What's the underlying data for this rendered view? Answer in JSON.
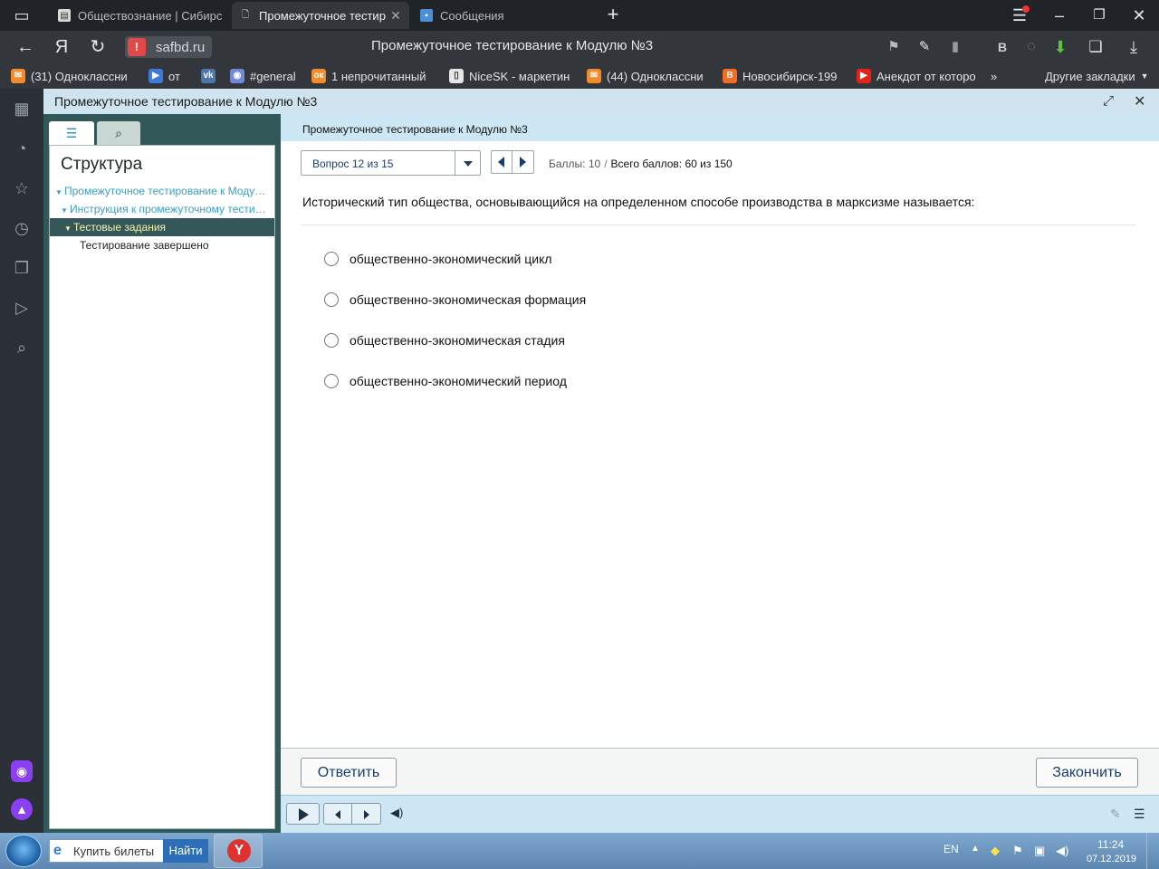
{
  "browser": {
    "tabs": [
      {
        "title": "Обществознание | Сибирс"
      },
      {
        "title": "Промежуточное тестир"
      },
      {
        "title": "Сообщения"
      }
    ],
    "address": {
      "domain": "safbd.ru",
      "page_title": "Промежуточное тестирование к Модулю №3"
    },
    "bookmarks": [
      {
        "label": "(31) Одноклассни",
        "color": "#f28b2c"
      },
      {
        "label": "от",
        "color": "#3d7bd9"
      },
      {
        "label": "",
        "color": "#4a76a8"
      },
      {
        "label": "#general",
        "color": "#7289da"
      },
      {
        "label": "1 непрочитанный",
        "color": "#f28b2c"
      },
      {
        "label": "NiceSK - маркетин",
        "color": "#e6e6e6"
      },
      {
        "label": "(44) Одноклассни",
        "color": "#f28b2c"
      },
      {
        "label": "Новосибирск-199",
        "color": "#f26d21"
      },
      {
        "label": "Анекдот от которо",
        "color": "#e62117"
      }
    ],
    "other_bookmarks": "Другие закладки"
  },
  "player": {
    "window_title": "Промежуточное тестирование к Модулю №3",
    "outline": {
      "heading": "Структура",
      "items": [
        {
          "label": "Промежуточное тестирование к Моду…",
          "level": 0
        },
        {
          "label": "Инструкция к промежуточному тести…",
          "level": 1
        },
        {
          "label": "Тестовые задания",
          "level": 1
        },
        {
          "label": "Тестирование завершено",
          "level": 2
        }
      ]
    },
    "header_title": "Промежуточное тестирование к Модулю №3",
    "question_select": "Вопрос 12 из 15",
    "score": {
      "points_label": "Баллы: 10",
      "total_label": "Всего баллов: 60 из 150"
    },
    "question": "Исторический тип общества, основывающийся на определенном способе производства в марксизме называется:",
    "options": [
      {
        "label": "общественно-экономический цикл"
      },
      {
        "label": "общественно-экономическая формация"
      },
      {
        "label": "общественно-экономическая стадия"
      },
      {
        "label": "общественно-экономический период"
      }
    ],
    "buttons": {
      "answer": "Ответить",
      "finish": "Закончить"
    }
  },
  "taskbar": {
    "search_text": "Купить билеты",
    "search_button": "Найти",
    "language": "EN",
    "time": "11:24",
    "date": "07.12.2019"
  },
  "icons": {
    "sidebar": [
      "grid-icon",
      "bell-icon",
      "star-icon",
      "history-icon",
      "collections-icon",
      "play-circle-icon",
      "search-page-icon",
      "alice-icon",
      "alice-voice-icon"
    ],
    "accent_selected": "#35575a",
    "link_color": "#3a9fc6"
  }
}
